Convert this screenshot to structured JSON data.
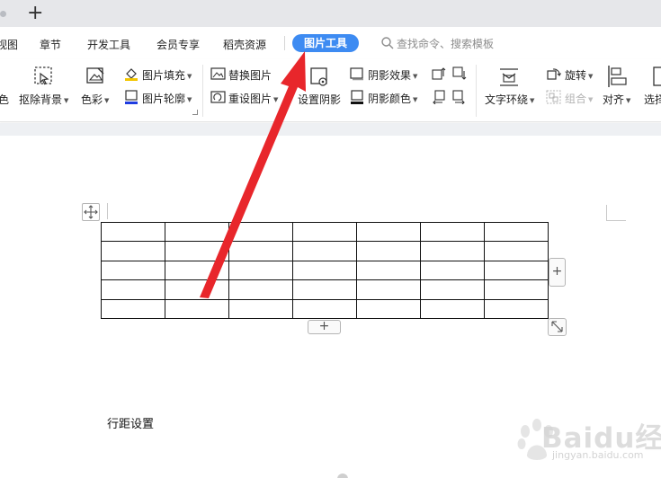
{
  "titlebar": {
    "new_tab_label": "+"
  },
  "menu": {
    "tabs": [
      {
        "label": "视图",
        "active": false
      },
      {
        "label": "章节",
        "active": false
      },
      {
        "label": "开发工具",
        "active": false
      },
      {
        "label": "会员专享",
        "active": false
      },
      {
        "label": "稻壳资源",
        "active": false
      },
      {
        "label": "图片工具",
        "active": true
      }
    ],
    "search_placeholder": "查找命令、搜索模板",
    "accent_color": "#3d8bf2"
  },
  "ribbon": {
    "color_partial": "色",
    "remove_bg": "抠除背景",
    "color": "色彩",
    "picture_fill": "图片填充",
    "picture_outline": "图片轮廓",
    "replace_picture": "替换图片",
    "reset_picture": "重设图片",
    "set_shadow": "设置阴影",
    "shadow_effect": "阴影效果",
    "shadow_color": "阴影颜色",
    "text_wrap": "文字环绕",
    "rotate": "旋转",
    "group": "组合",
    "align": "对齐",
    "select_partial": "选择"
  },
  "table": {
    "rows": 5,
    "cols": 7,
    "add_column_label": "+",
    "add_row_label": "+"
  },
  "document": {
    "body_text": "行距设置"
  },
  "annotation": {
    "arrow_color": "#e8262b"
  },
  "watermark": {
    "brand": "Baidu经验",
    "url": "jingyan.baidu.com",
    "icon": "baidu-paw-icon"
  }
}
